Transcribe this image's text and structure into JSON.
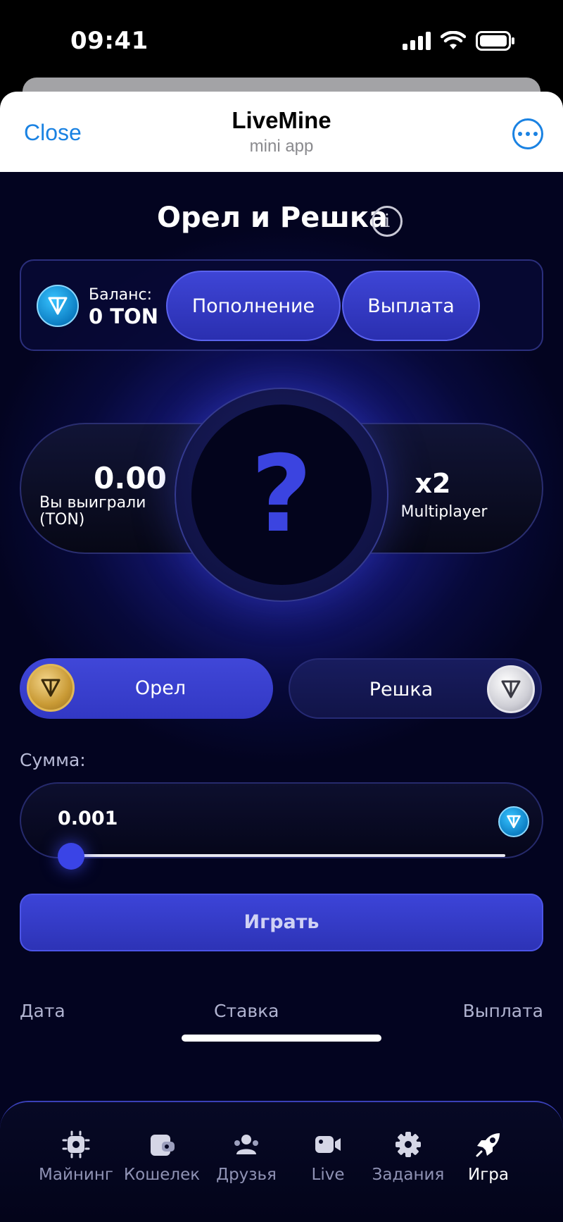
{
  "status_bar": {
    "time": "09:41"
  },
  "header": {
    "close_label": "Close",
    "title": "LiveMine",
    "subtitle": "mini app"
  },
  "game": {
    "title": "Орел и Решка",
    "balance": {
      "label": "Баланс:",
      "value": "0 TON"
    },
    "deposit_label": "Пополнение",
    "withdraw_label": "Выплата",
    "win_value": "0.00",
    "win_label": "Вы выиграли (TON)",
    "coin_mark": "?",
    "multiplier_value": "x2",
    "multiplier_label": "Multiplayer",
    "heads_label": "Орел",
    "tails_label": "Решка",
    "amount_label": "Сумма:",
    "amount_value": "0.001",
    "slider_fraction": 0,
    "play_label": "Играть",
    "history_headers": [
      "Дата",
      "Ставка",
      "Выплата"
    ]
  },
  "nav": {
    "items": [
      {
        "label": "Майнинг",
        "icon": "chip-icon"
      },
      {
        "label": "Кошелек",
        "icon": "wallet-icon"
      },
      {
        "label": "Друзья",
        "icon": "friends-icon"
      },
      {
        "label": "Live",
        "icon": "video-camera-icon"
      },
      {
        "label": "Задания",
        "icon": "gear-icon"
      },
      {
        "label": "Игра",
        "icon": "rocket-icon"
      }
    ],
    "active_index": 5
  },
  "colors": {
    "accent": "#3b44e0",
    "link": "#1a82e2",
    "background": "#07093a"
  }
}
